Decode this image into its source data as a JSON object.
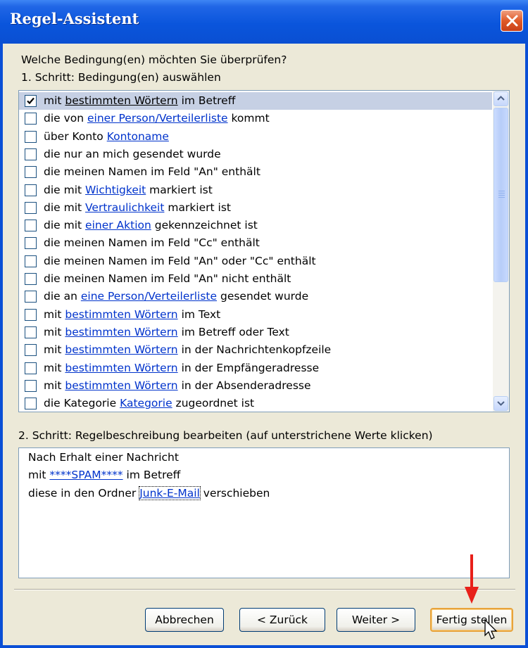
{
  "window": {
    "title": "Regel-Assistent"
  },
  "prompt": "Welche Bedingung(en) möchten Sie überprüfen?",
  "step1_label": "1. Schritt: Bedingung(en) auswählen",
  "conditions": [
    {
      "checked": true,
      "pre": "mit ",
      "link": "bestimmten Wörtern",
      "post": " im Betreff"
    },
    {
      "checked": false,
      "pre": "die von ",
      "link": "einer Person/Verteilerliste",
      "post": " kommt"
    },
    {
      "checked": false,
      "pre": "über Konto ",
      "link": "Kontoname",
      "post": ""
    },
    {
      "checked": false,
      "pre": "die nur an mich gesendet wurde",
      "link": "",
      "post": ""
    },
    {
      "checked": false,
      "pre": "die meinen Namen im Feld \"An\" enthält",
      "link": "",
      "post": ""
    },
    {
      "checked": false,
      "pre": "die mit ",
      "link": "Wichtigkeit",
      "post": " markiert ist"
    },
    {
      "checked": false,
      "pre": "die mit ",
      "link": "Vertraulichkeit",
      "post": " markiert ist"
    },
    {
      "checked": false,
      "pre": "die mit ",
      "link": "einer Aktion",
      "post": " gekennzeichnet ist"
    },
    {
      "checked": false,
      "pre": "die meinen Namen im Feld \"Cc\" enthält",
      "link": "",
      "post": ""
    },
    {
      "checked": false,
      "pre": "die meinen Namen im Feld \"An\" oder \"Cc\" enthält",
      "link": "",
      "post": ""
    },
    {
      "checked": false,
      "pre": "die meinen Namen im Feld \"An\" nicht enthält",
      "link": "",
      "post": ""
    },
    {
      "checked": false,
      "pre": "die an ",
      "link": "eine Person/Verteilerliste",
      "post": " gesendet wurde"
    },
    {
      "checked": false,
      "pre": "mit ",
      "link": "bestimmten Wörtern",
      "post": " im Text"
    },
    {
      "checked": false,
      "pre": "mit ",
      "link": "bestimmten Wörtern",
      "post": " im Betreff oder Text"
    },
    {
      "checked": false,
      "pre": "mit ",
      "link": "bestimmten Wörtern",
      "post": " in der Nachrichtenkopfzeile"
    },
    {
      "checked": false,
      "pre": "mit ",
      "link": "bestimmten Wörtern",
      "post": " in der Empfängeradresse"
    },
    {
      "checked": false,
      "pre": "mit ",
      "link": "bestimmten Wörtern",
      "post": " in der Absenderadresse"
    },
    {
      "checked": false,
      "pre": "die Kategorie ",
      "link": "Kategorie",
      "post": " zugeordnet ist"
    }
  ],
  "step2_label": "2. Schritt: Regelbeschreibung bearbeiten (auf unterstrichene Werte klicken)",
  "description": {
    "line1": "Nach Erhalt einer Nachricht",
    "line2_pre": "mit ",
    "line2_link": "****SPAM****",
    "line2_post": " im Betreff",
    "line3_pre": "diese in den Ordner ",
    "line3_link": "Junk-E-Mail",
    "line3_post": " verschieben"
  },
  "buttons": {
    "cancel": "Abbrechen",
    "back": "< Zurück",
    "next": "Weiter >",
    "finish": "Fertig stellen"
  },
  "colors": {
    "title_bar": "#0a55dc",
    "link": "#0033cc",
    "annotation_arrow": "#e8201a",
    "dialog_bg": "#ece9d8"
  }
}
